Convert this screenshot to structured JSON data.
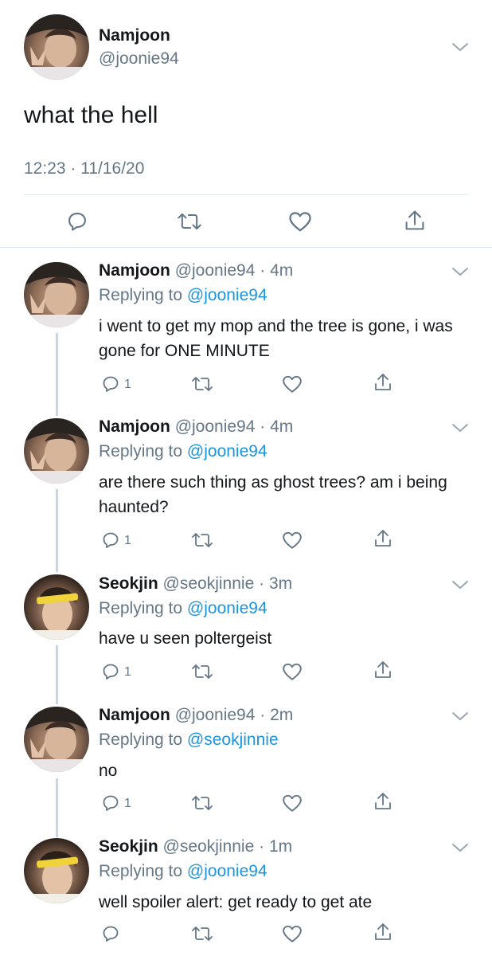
{
  "main_tweet": {
    "name": "Namjoon",
    "handle": "@joonie94",
    "text": "what the hell",
    "timestamp": "12:23 · 11/16/20",
    "avatar": "namjoon-avatar"
  },
  "replies": [
    {
      "name": "Namjoon",
      "handle": "@joonie94",
      "time": "4m",
      "replying_label": "Replying to",
      "replying_to": "@joonie94",
      "text": "i went to get my mop and the tree is gone, i was gone for ONE MINUTE",
      "reply_count": "1",
      "avatar": "namjoon-avatar"
    },
    {
      "name": "Namjoon",
      "handle": "@joonie94",
      "time": "4m",
      "replying_label": "Replying to",
      "replying_to": "@joonie94",
      "text": "are there such thing as ghost trees? am i being haunted?",
      "reply_count": "1",
      "avatar": "namjoon-avatar"
    },
    {
      "name": "Seokjin",
      "handle": "@seokjinnie",
      "time": "3m",
      "replying_label": "Replying to",
      "replying_to": "@joonie94",
      "text": "have u seen poltergeist",
      "reply_count": "1",
      "avatar": "seokjin-avatar"
    },
    {
      "name": "Namjoon",
      "handle": "@joonie94",
      "time": "2m",
      "replying_label": "Replying to",
      "replying_to": "@seokjinnie",
      "text": "no",
      "reply_count": "1",
      "avatar": "namjoon-avatar"
    },
    {
      "name": "Seokjin",
      "handle": "@seokjinnie",
      "time": "1m",
      "replying_label": "Replying to",
      "replying_to": "@joonie94",
      "text": "well spoiler alert: get ready to get ate",
      "reply_count": "",
      "avatar": "seokjin-avatar"
    }
  ],
  "colors": {
    "link": "#1b95e0",
    "secondary": "#657786",
    "text": "#14171a",
    "divider": "#e1e8ed"
  }
}
